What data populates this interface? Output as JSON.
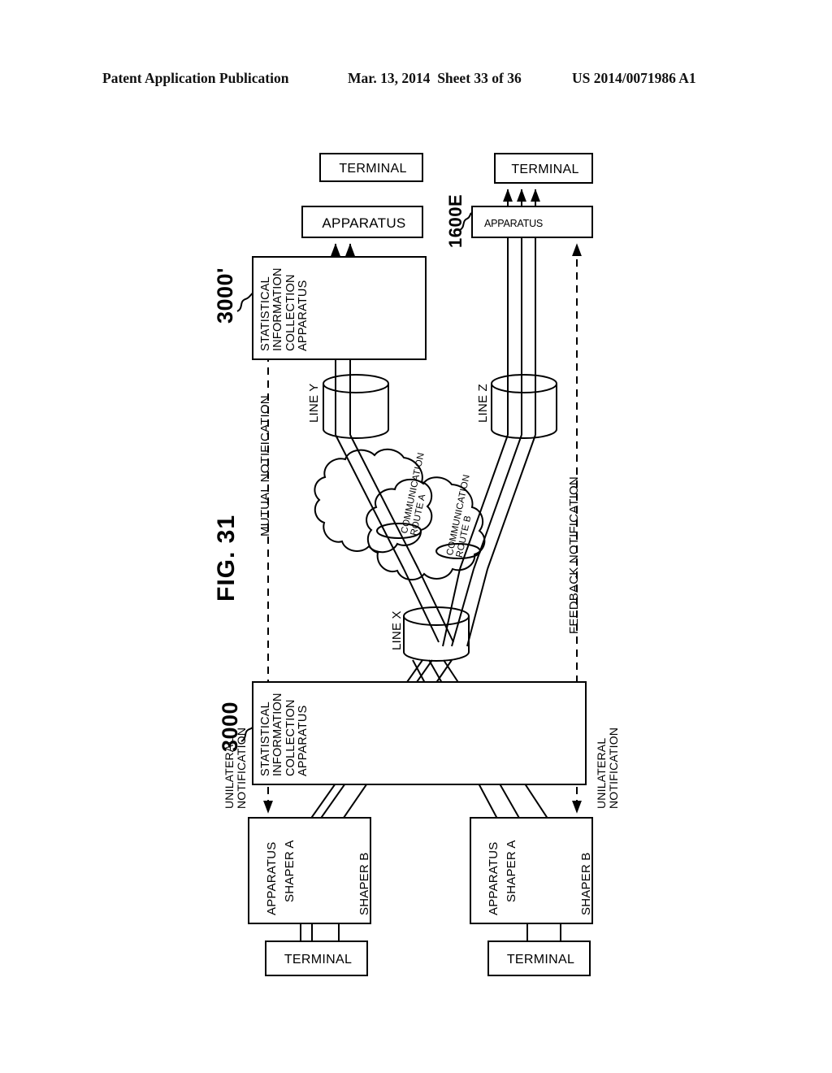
{
  "header": {
    "publication": "Patent Application Publication",
    "date": "Mar. 13, 2014",
    "sheet": "Sheet 33 of 36",
    "patent_number": "US 2014/0071986 A1"
  },
  "figure": {
    "label": "FIG. 31"
  },
  "reference_numerals": {
    "upper_collection_apparatus": "3000'",
    "lower_collection_apparatus": "3000",
    "upper_right_apparatus": "1600E"
  },
  "notifications": {
    "mutual": "MUTUAL NOTIFICATION",
    "feedback": "FEEDBACK NOTIFICATION",
    "unilateral_left": "UNILATERAL\nNOTIFICATION",
    "unilateral_left_l1": "UNILATERAL",
    "unilateral_left_l2": "NOTIFICATION",
    "unilateral_right_l1": "UNILATERAL",
    "unilateral_right_l2": "NOTIFICATION"
  },
  "top_blocks": {
    "terminal_left": "TERMINAL",
    "terminal_right": "TERMINAL",
    "apparatus_left": "APPARATUS",
    "apparatus_right": "APPARATUS"
  },
  "collection_apparatus_text": {
    "line1": "STATISTICAL",
    "line2": "INFORMATION",
    "line3": "COLLECTION",
    "line4": "APPARATUS"
  },
  "lines": {
    "line_y": "LINE Y",
    "line_z": "LINE Z",
    "line_x": "LINE X"
  },
  "cloud": {
    "route_a_l1": "COMMUNICATION",
    "route_a_l2": "ROUTE A",
    "route_b_l1": "COMMUNICATION",
    "route_b_l2": "ROUTE B"
  },
  "bottom_blocks": {
    "apparatus_left": "APPARATUS",
    "apparatus_right": "APPARATUS",
    "shaper_a_left": "SHAPER A",
    "shaper_b_left": "SHAPER B",
    "shaper_a_right": "SHAPER A",
    "shaper_b_right": "SHAPER B",
    "terminal_left": "TERMINAL",
    "terminal_right": "TERMINAL"
  },
  "colors": {
    "ink": "#000000",
    "paper": "#ffffff"
  }
}
